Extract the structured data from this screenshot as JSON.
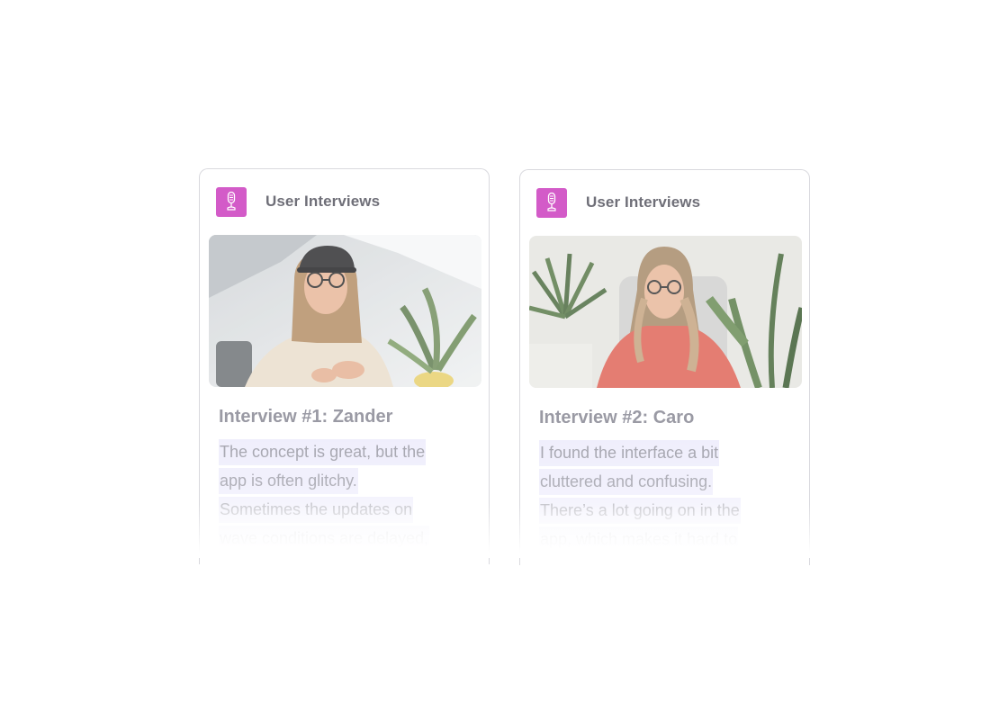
{
  "cards": [
    {
      "app_label": "User Interviews",
      "app_icon": "microphone-icon",
      "title": "Interview #1: Zander",
      "quote_lines": [
        "The concept is great, but the",
        "app is often glitchy.",
        "Sometimes the updates on",
        "wave conditions are delayed,"
      ]
    },
    {
      "app_label": "User Interviews",
      "app_icon": "microphone-icon",
      "title": "Interview #2: Caro",
      "quote_lines": [
        "I found the interface a bit",
        "cluttered and confusing.",
        "There’s a lot going on in the",
        "app, which makes it hard to"
      ]
    }
  ],
  "colors": {
    "icon_background": "#d35bc8",
    "highlight": "#efeefc",
    "label_text": "#6f6f78",
    "title_text": "#9a9aa4",
    "quote_text": "#a3a3ad"
  }
}
